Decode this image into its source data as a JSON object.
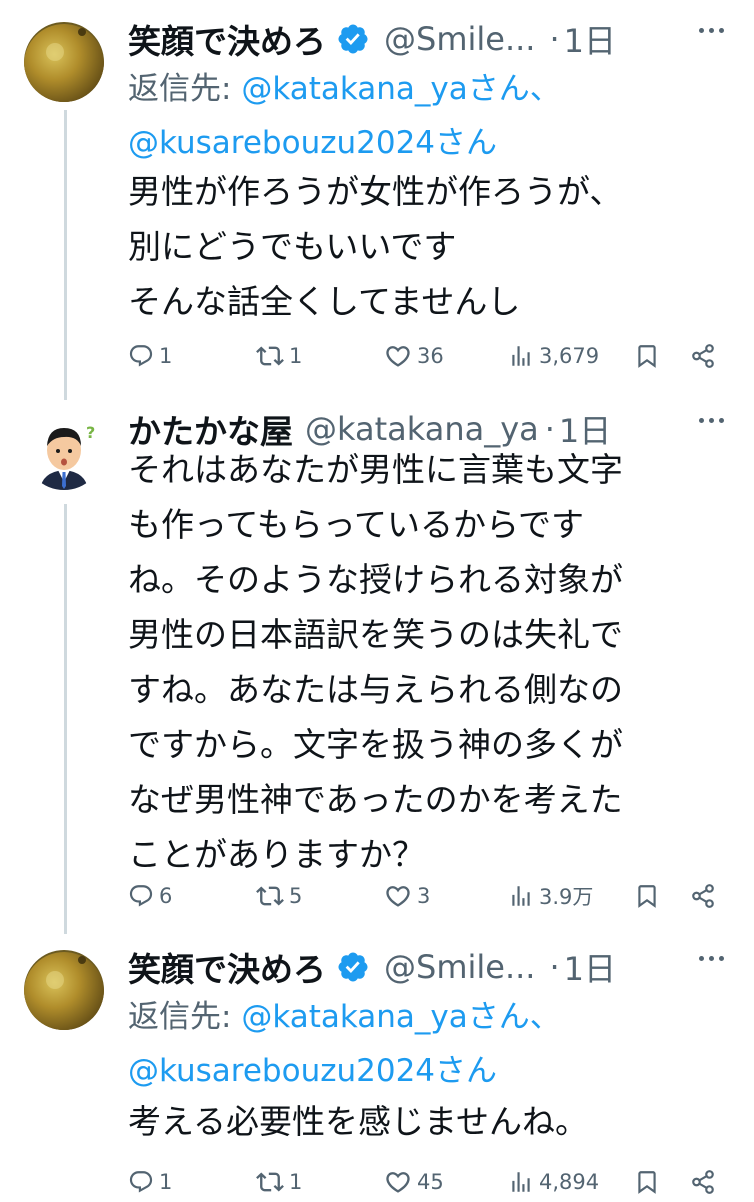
{
  "colors": {
    "link": "#1d9bf0",
    "muted": "#536471",
    "text": "#0f1419",
    "verified": "#1d9bf0",
    "thread_line": "#cfd9de"
  },
  "tweets": [
    {
      "name": "笑顔で決めろ",
      "handle": "@Smile...",
      "dot": "·",
      "time": "1日",
      "verified": true,
      "avatar_icon": "orange-fruit-avatar",
      "reply_prefix": "返信先: ",
      "reply_mention_1": "@katakana_yaさん、",
      "reply_mention_2": "@kusarebouzu2024さん",
      "text": "男性が作ろうが女性が作ろうが、\n別にどうでもいいです\nそんな話全くしてませんし",
      "replies": "1",
      "retweets": "1",
      "likes": "36",
      "views": "3,679"
    },
    {
      "name": "かたかな屋",
      "handle": "@katakana_ya",
      "dot": "·",
      "time": "1日",
      "verified": false,
      "avatar_icon": "businessman-avatar",
      "text": "それはあなたが男性に言葉も文字\nも作ってもらっているからです\nね。そのような授けられる対象が\n男性の日本語訳を笑うのは失礼で\nすね。あなたは与えられる側なの\nですから。文字を扱う神の多くが\nなぜ男性神であったのかを考えた\nことがありますか？",
      "replies": "6",
      "retweets": "5",
      "likes": "3",
      "views": "3.9万"
    },
    {
      "name": "笑顔で決めろ",
      "handle": "@Smile...",
      "dot": "·",
      "time": "1日",
      "verified": true,
      "avatar_icon": "orange-fruit-avatar",
      "reply_prefix": "返信先: ",
      "reply_mention_1": "@katakana_yaさん、",
      "reply_mention_2": "@kusarebouzu2024さん",
      "text": "考える必要性を感じませんね。",
      "replies": "1",
      "retweets": "1",
      "likes": "45",
      "views": "4,894"
    }
  ],
  "icons": {
    "reply": "reply-icon",
    "retweet": "retweet-icon",
    "like": "heart-icon",
    "views": "views-chart-icon",
    "bookmark": "bookmark-icon",
    "share": "share-icon",
    "more": "more-icon",
    "verified": "verified-badge-icon"
  }
}
